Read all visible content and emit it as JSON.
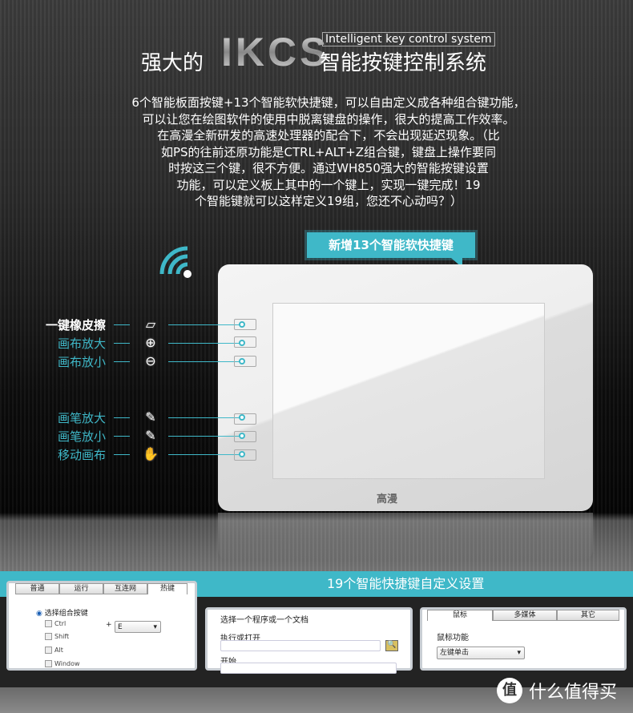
{
  "header": {
    "title_prefix": "强大的",
    "brand": "IKCS",
    "subtitle_en": "Intelligent key control system",
    "title_suffix": "智能按键控制系统"
  },
  "description": [
    "6个智能板面按键+13个智能软快捷键，可以自由定义成各种组合键功能，",
    "可以让您在绘图软件的使用中脱离键盘的操作，很大的提高工作效率。",
    "在高漫全新研发的高速处理器的配合下，不会出现延迟现象。（比",
    "如PS的往前还原功能是CTRL+ALT+Z组合键，键盘上操作要同",
    "时按这三个键，很不方便。通过WH850强大的智能按键设置",
    "功能，可以定义板上其中的一个键上，实现一键完成！19",
    "个智能键就可以这样定义19组，您还不心动吗？）"
  ],
  "callout": "新增13个智能软快捷键",
  "tablet_logo": "高漫",
  "hotkeys": [
    {
      "label": "一键橡皮擦",
      "icon": "eraser-icon",
      "glyph": "▱"
    },
    {
      "label": "画布放大",
      "icon": "zoom-in-icon",
      "glyph": "⊕"
    },
    {
      "label": "画布放小",
      "icon": "zoom-out-icon",
      "glyph": "⊖"
    },
    {
      "label": "画笔放大",
      "icon": "pen-plus-icon",
      "glyph": "✎"
    },
    {
      "label": "画笔放小",
      "icon": "pen-minus-icon",
      "glyph": "✎"
    },
    {
      "label": "移动画布",
      "icon": "hand-icon",
      "glyph": "✋"
    }
  ],
  "band_title": "19个智能快捷键自定义设置",
  "panel1": {
    "tabs": [
      "普通",
      "运行",
      "互连网",
      "热键"
    ],
    "radio": "选择组合按键",
    "checkboxes": [
      "Ctrl",
      "Shift",
      "Alt",
      "Window"
    ],
    "plus": "+",
    "key_value": "E"
  },
  "panel2": {
    "heading": "选择一个程序或一个文档",
    "field1_label": "执行或打开",
    "field2_label": "开始"
  },
  "panel3": {
    "tabs": [
      "鼠标",
      "多媒体",
      "其它"
    ],
    "label": "鼠标功能",
    "select_value": "左键单击"
  },
  "watermark": {
    "icon_char": "值",
    "text": "什么值得买"
  },
  "colors": {
    "accent": "#3fb8c8",
    "background": "#111111"
  }
}
